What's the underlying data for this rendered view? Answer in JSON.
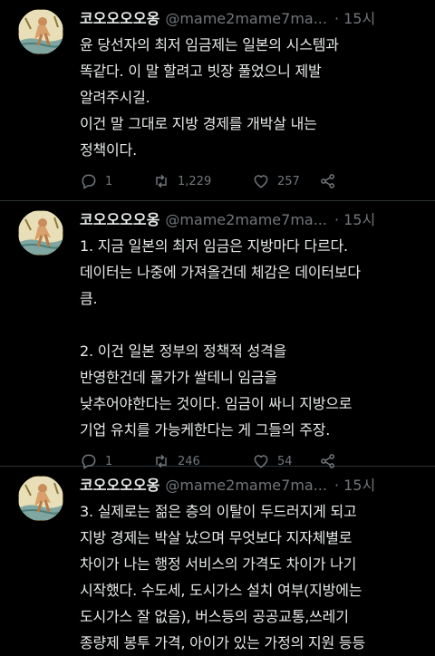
{
  "tweets": [
    {
      "name": "코오오오오옹",
      "handle": "@mame2mame7ma",
      "ellipsis": "...",
      "dot": "·",
      "time": "15시",
      "text": "윤 당선자의 최저 임금제는 일본의 시스템과\n똑같다. 이 말 할려고 빗장 풀었으니 제발\n알려주시길.\n 이건 말 그대로 지방 경제를 개박살 내는\n정책이다.",
      "replies": "1",
      "retweets": "1,229",
      "likes": "257"
    },
    {
      "name": "코오오오오옹",
      "handle": "@mame2mame7ma",
      "ellipsis": "...",
      "dot": "·",
      "time": "15시",
      "text": "1. 지금 일본의 최저 임금은 지방마다 다르다.\n데이터는 나중에 가져올건데 체감은 데이터보다\n큼.\n\n2. 이건 일본 정부의 정책적 성격을\n반영한건데 물가가 쌀테니 임금을\n낮추어야한다는 것이다. 임금이 싸니 지방으로\n기업 유치를 가능케한다는 게 그들의 주장.",
      "replies": "1",
      "retweets": "246",
      "likes": "54"
    },
    {
      "name": "코오오오오옹",
      "handle": "@mame2mame7ma",
      "ellipsis": "...",
      "dot": "·",
      "time": "15시",
      "text": "3. 실제로는 젊은 층의 이탈이 두드러지게 되고\n지방 경제는 박살 났으며 무엇보다 지자체별로\n차이가 나는 행정 서비스의 가격도 차이가 나기\n시작했다. 수도세, 도시가스 설치 여부(지방에는\n도시가스 잘 없음), 버스등의 공공교통,쓰레기\n종량제 봉투 가격, 아이가 있는 가정의 지원 등등"
    }
  ]
}
